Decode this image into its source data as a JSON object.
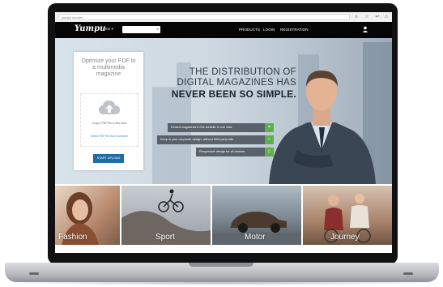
{
  "browser": {
    "url": "yumpu.com/en"
  },
  "nav": {
    "logo": "Yumpu",
    "lang": "EN ▾",
    "links": [
      "PRODUCTS",
      "LOGIN",
      "REGISTRATION"
    ]
  },
  "card": {
    "title_line1": "Optimize your PDF to",
    "title_line2": "a multimedia",
    "title_line3": "magazine",
    "drop_text": "Drag a PDF file in this area",
    "drop_link": "Select PDF file from computer",
    "upload_button": "START UPLOAD"
  },
  "headline": {
    "line1": "THE DISTRIBUTION OF",
    "line2": "DIGITAL MAGAZINES HAS",
    "line3": "NEVER BEEN SO SIMPLE."
  },
  "features": [
    {
      "text": "Embed magazines in the website in one click",
      "icon": "link-icon"
    },
    {
      "text": "Keep in your corporate design, without third party ads",
      "icon": "check-icon"
    },
    {
      "text": "Responsive design for all devices",
      "icon": "mobile-icon"
    }
  ],
  "categories": [
    {
      "label": "Fashion",
      "color": "#b98a6e"
    },
    {
      "label": "Sport",
      "color": "#8b8e94"
    },
    {
      "label": "Motor",
      "color": "#6e7880"
    },
    {
      "label": "Journey",
      "color": "#a9836a"
    }
  ],
  "colors": {
    "accent_blue": "#1b6ea8",
    "accent_green": "#5db04c",
    "nav_bg": "#050505"
  },
  "slider": {
    "active": 2,
    "count": 4
  }
}
